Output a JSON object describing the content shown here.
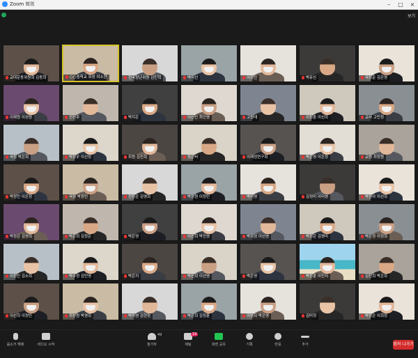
{
  "window": {
    "title": "Zoom 회의"
  },
  "topbar": {
    "view_label": "보기"
  },
  "participants": [
    {
      "name": "교대운동위원회 김동희"
    },
    {
      "name": "○○중학교 회장 이소현"
    },
    {
      "name": "전국청년위원 김민혁"
    },
    {
      "name": "박미선"
    },
    {
      "name": "이정민"
    },
    {
      "name": "박유신"
    },
    {
      "name": "국정준 김은영"
    },
    {
      "name": "이제원 이성원"
    },
    {
      "name": "전진주"
    },
    {
      "name": "박지은"
    },
    {
      "name": "이선민 최인영"
    },
    {
      "name": "고원태"
    },
    {
      "name": "이정훈 이선희"
    },
    {
      "name": "교사 고민정"
    },
    {
      "name": "국정 박은희"
    },
    {
      "name": "박정우 이선정"
    },
    {
      "name": "회원 김진희"
    },
    {
      "name": "정은비"
    },
    {
      "name": "이재정연구회"
    },
    {
      "name": "박은영 이은정"
    },
    {
      "name": "교원 최정원"
    },
    {
      "name": "박정민 이은정"
    },
    {
      "name": "국정 박정민"
    },
    {
      "name": "전정은 김영희"
    },
    {
      "name": "박정원 이정민"
    },
    {
      "name": "박미영"
    },
    {
      "name": "김정미 이미영"
    },
    {
      "name": "박정아 이선희"
    },
    {
      "name": "박정은 김영희"
    },
    {
      "name": "박은희 김정은"
    },
    {
      "name": "박은영"
    },
    {
      "name": "이진희 박진영"
    },
    {
      "name": "박희정 이선영"
    },
    {
      "name": "박정은 김영미"
    },
    {
      "name": "박은정 이정희"
    },
    {
      "name": "이정민 김소희"
    },
    {
      "name": "박수정 김민영"
    },
    {
      "name": "박은지"
    },
    {
      "name": "박진희 이선영"
    },
    {
      "name": "박은영"
    },
    {
      "name": "박정훈 이민지"
    },
    {
      "name": "김진희 박은희"
    },
    {
      "name": "이선희 이정민"
    },
    {
      "name": "최정원 박영희"
    },
    {
      "name": "박미영 김현정"
    },
    {
      "name": "박은희 김정훈"
    },
    {
      "name": "이영희 박은영"
    },
    {
      "name": "김미정"
    },
    {
      "name": "박정은 이희정"
    }
  ],
  "toolbar": {
    "mute_label": "음소거 해제",
    "video_label": "비디오 시작",
    "participants_label": "참가자",
    "participants_count": "49",
    "chat_label": "채팅",
    "chat_badge": "19",
    "share_label": "화면 공유",
    "record_label": "기록",
    "reactions_label": "반응",
    "more_label": "추가",
    "end_label": "회의 나가기"
  },
  "colors": {
    "accent": "#2d8cff",
    "active_speaker": "#d6c229",
    "end": "#d32b2b"
  }
}
